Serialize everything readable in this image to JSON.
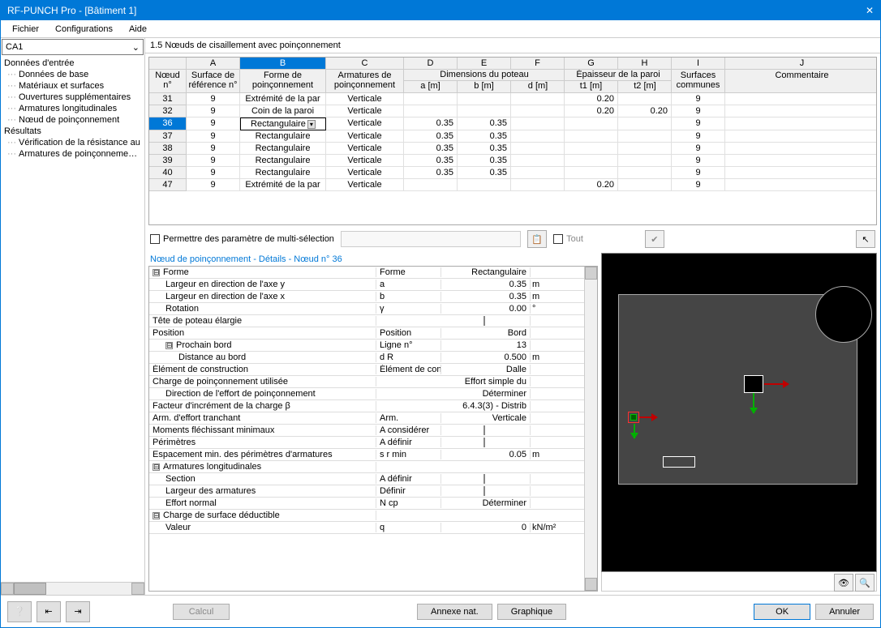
{
  "title": "RF-PUNCH Pro - [Bâtiment 1]",
  "menu": {
    "file": "Fichier",
    "config": "Configurations",
    "help": "Aide"
  },
  "combo_ca": "CA1",
  "tree": {
    "input_root": "Données d'entrée",
    "input": [
      "Données de base",
      "Matériaux et surfaces",
      "Ouvertures supplémentaires",
      "Armatures longitudinales",
      "Nœud de poinçonnement"
    ],
    "results_root": "Résultats",
    "results": [
      "Vérification de la résistance au",
      "Armatures de poinçonnement r"
    ]
  },
  "section_title": "1.5  Nœuds de cisaillement avec poinçonnement",
  "grid": {
    "col_letters": [
      "A",
      "B",
      "C",
      "D",
      "E",
      "F",
      "G",
      "H",
      "I",
      "J"
    ],
    "h_noeud": "Nœud\nn°",
    "h_surf": "Surface de\nréférence n°",
    "h_forme": "Forme de\npoinçonnement",
    "h_arm": "Armatures de\npoinçonnement",
    "h_dim": "Dimensions du poteau",
    "h_a": "a [m]",
    "h_b": "b [m]",
    "h_d": "d [m]",
    "h_ep": "Épaisseur de la paroi",
    "h_t1": "t1 [m]",
    "h_t2": "t2 [m]",
    "h_sc": "Surfaces\ncommunes",
    "h_com": "Commentaire",
    "rows": [
      {
        "n": "31",
        "surf": "9",
        "forme": "Extrémité de la par",
        "arm": "Verticale",
        "a": "",
        "b": "",
        "d": "",
        "t1": "0.20",
        "t2": "",
        "sc": "9",
        "com": ""
      },
      {
        "n": "32",
        "surf": "9",
        "forme": "Coin de la paroi",
        "arm": "Verticale",
        "a": "",
        "b": "",
        "d": "",
        "t1": "0.20",
        "t2": "0.20",
        "sc": "9",
        "com": ""
      },
      {
        "n": "36",
        "surf": "9",
        "forme": "Rectangulaire",
        "arm": "Verticale",
        "a": "0.35",
        "b": "0.35",
        "d": "",
        "t1": "",
        "t2": "",
        "sc": "9",
        "com": ""
      },
      {
        "n": "37",
        "surf": "9",
        "forme": "Rectangulaire",
        "arm": "Verticale",
        "a": "0.35",
        "b": "0.35",
        "d": "",
        "t1": "",
        "t2": "",
        "sc": "9",
        "com": ""
      },
      {
        "n": "38",
        "surf": "9",
        "forme": "Rectangulaire",
        "arm": "Verticale",
        "a": "0.35",
        "b": "0.35",
        "d": "",
        "t1": "",
        "t2": "",
        "sc": "9",
        "com": ""
      },
      {
        "n": "39",
        "surf": "9",
        "forme": "Rectangulaire",
        "arm": "Verticale",
        "a": "0.35",
        "b": "0.35",
        "d": "",
        "t1": "",
        "t2": "",
        "sc": "9",
        "com": ""
      },
      {
        "n": "40",
        "surf": "9",
        "forme": "Rectangulaire",
        "arm": "Verticale",
        "a": "0.35",
        "b": "0.35",
        "d": "",
        "t1": "",
        "t2": "",
        "sc": "9",
        "com": ""
      },
      {
        "n": "47",
        "surf": "9",
        "forme": "Extrémité de la par",
        "arm": "Verticale",
        "a": "",
        "b": "",
        "d": "",
        "t1": "0.20",
        "t2": "",
        "sc": "9",
        "com": ""
      }
    ],
    "selected_row": 2
  },
  "multi_select": "Permettre des paramètre de multi-sélection",
  "tout": "Tout",
  "details_title": "Nœud de poinçonnement - Détails - Nœud n° 36",
  "details": [
    {
      "exp": "-",
      "lvl": 0,
      "label": "Forme",
      "sym": "Forme",
      "val": "Rectangulaire",
      "unit": ""
    },
    {
      "lvl": 1,
      "label": "Largeur en direction de l'axe y",
      "sym": "a",
      "val": "0.35",
      "unit": "m"
    },
    {
      "lvl": 1,
      "label": "Largeur en direction de l'axe x",
      "sym": "b",
      "val": "0.35",
      "unit": "m"
    },
    {
      "lvl": 1,
      "label": "Rotation",
      "sym": "γ",
      "val": "0.00",
      "unit": "°"
    },
    {
      "lvl": 0,
      "label": "Tête de poteau élargie",
      "sym": "",
      "val": "☐",
      "unit": ""
    },
    {
      "lvl": 0,
      "label": "Position",
      "sym": "Position",
      "val": "Bord",
      "unit": ""
    },
    {
      "exp": "-",
      "lvl": 1,
      "label": "Prochain bord",
      "sym": "Ligne n°",
      "val": "13",
      "unit": ""
    },
    {
      "lvl": 2,
      "label": "Distance au bord",
      "sym": "d R",
      "val": "0.500",
      "unit": "m"
    },
    {
      "lvl": 0,
      "label": "Élément de construction",
      "sym": "Élément de con:",
      "val": "Dalle",
      "unit": ""
    },
    {
      "lvl": 0,
      "label": "Charge de poinçonnement utilisée",
      "sym": "",
      "val": "Effort simple du",
      "unit": ""
    },
    {
      "lvl": 1,
      "label": "Direction de l'effort de poinçonnement",
      "sym": "",
      "val": "Déterminer",
      "unit": ""
    },
    {
      "lvl": 0,
      "label": "Facteur d'incrément de la charge β",
      "sym": "",
      "val": "6.4.3(3) - Distrib",
      "unit": ""
    },
    {
      "lvl": 0,
      "label": "Arm. d'effort tranchant",
      "sym": "Arm.",
      "val": "Verticale",
      "unit": ""
    },
    {
      "lvl": 0,
      "label": "Moments fléchissant minimaux",
      "sym": "A considérer",
      "val": "☐",
      "unit": ""
    },
    {
      "lvl": 0,
      "label": "Périmètres",
      "sym": "A définir",
      "val": "☐",
      "unit": ""
    },
    {
      "lvl": 0,
      "label": "Espacement min. des périmètres d'armatures",
      "sym": "s r min",
      "val": "0.05",
      "unit": "m"
    },
    {
      "exp": "-",
      "lvl": 0,
      "label": "Armatures longitudinales",
      "sym": "",
      "val": "",
      "unit": ""
    },
    {
      "lvl": 1,
      "label": "Section",
      "sym": "A définir",
      "val": "☐",
      "unit": ""
    },
    {
      "lvl": 1,
      "label": "Largeur des armatures",
      "sym": "Définir",
      "val": "☐",
      "unit": ""
    },
    {
      "lvl": 1,
      "label": "Effort normal",
      "sym": "N cp",
      "val": "Déterminer",
      "unit": ""
    },
    {
      "exp": "-",
      "lvl": 0,
      "label": "Charge de surface déductible",
      "sym": "",
      "val": "",
      "unit": ""
    },
    {
      "lvl": 1,
      "label": "Valeur",
      "sym": "q",
      "val": "0",
      "unit": "kN/m²"
    }
  ],
  "buttons": {
    "calcul": "Calcul",
    "annexe": "Annexe nat.",
    "graphique": "Graphique",
    "ok": "OK",
    "annuler": "Annuler"
  }
}
